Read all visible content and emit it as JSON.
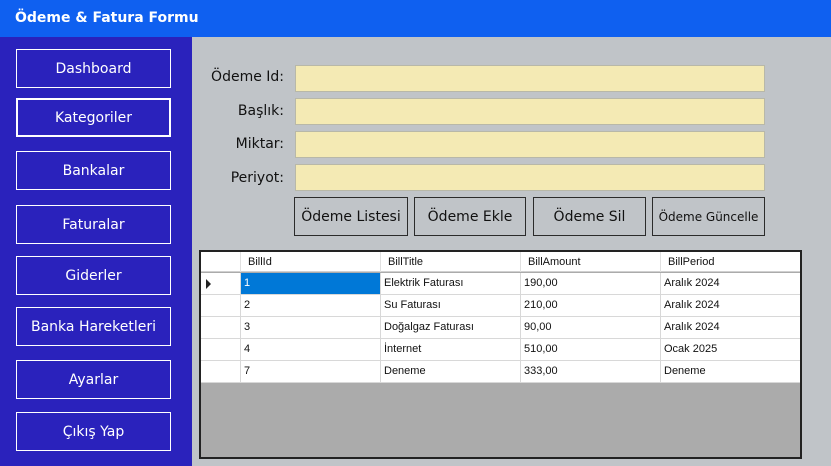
{
  "window": {
    "title": "Ödeme & Fatura Formu"
  },
  "sidebar": {
    "items": [
      {
        "label": "Dashboard"
      },
      {
        "label": "Kategoriler"
      },
      {
        "label": "Bankalar"
      },
      {
        "label": "Faturalar"
      },
      {
        "label": "Giderler"
      },
      {
        "label": "Banka Hareketleri"
      },
      {
        "label": "Ayarlar"
      },
      {
        "label": "Çıkış Yap"
      }
    ]
  },
  "form": {
    "fields": [
      {
        "label": "Ödeme Id:",
        "value": ""
      },
      {
        "label": "Başlık:",
        "value": ""
      },
      {
        "label": "Miktar:",
        "value": ""
      },
      {
        "label": "Periyot:",
        "value": ""
      }
    ]
  },
  "actions": {
    "list_label": "Ödeme Listesi",
    "add_label": "Ödeme Ekle",
    "delete_label": "Ödeme Sil",
    "update_label": "Ödeme Güncelle"
  },
  "grid": {
    "columns": [
      "BillId",
      "BillTitle",
      "BillAmount",
      "BillPeriod"
    ],
    "rows": [
      {
        "id": "1",
        "title": "Elektrik Faturası",
        "amount": "190,00",
        "period": "Aralık 2024"
      },
      {
        "id": "2",
        "title": "Su Faturası",
        "amount": "210,00",
        "period": "Aralık 2024"
      },
      {
        "id": "3",
        "title": "Doğalgaz Faturası",
        "amount": "90,00",
        "period": "Aralık 2024"
      },
      {
        "id": "4",
        "title": "İnternet",
        "amount": "510,00",
        "period": "Ocak 2025"
      },
      {
        "id": "7",
        "title": "Deneme",
        "amount": "333,00",
        "period": "Deneme"
      }
    ]
  },
  "colors": {
    "titlebar": "#0f60f0",
    "sidebar": "#2a22bc",
    "input_bg": "#f4eab4",
    "selection": "#0078d7",
    "content_bg": "#c0c4c8"
  }
}
